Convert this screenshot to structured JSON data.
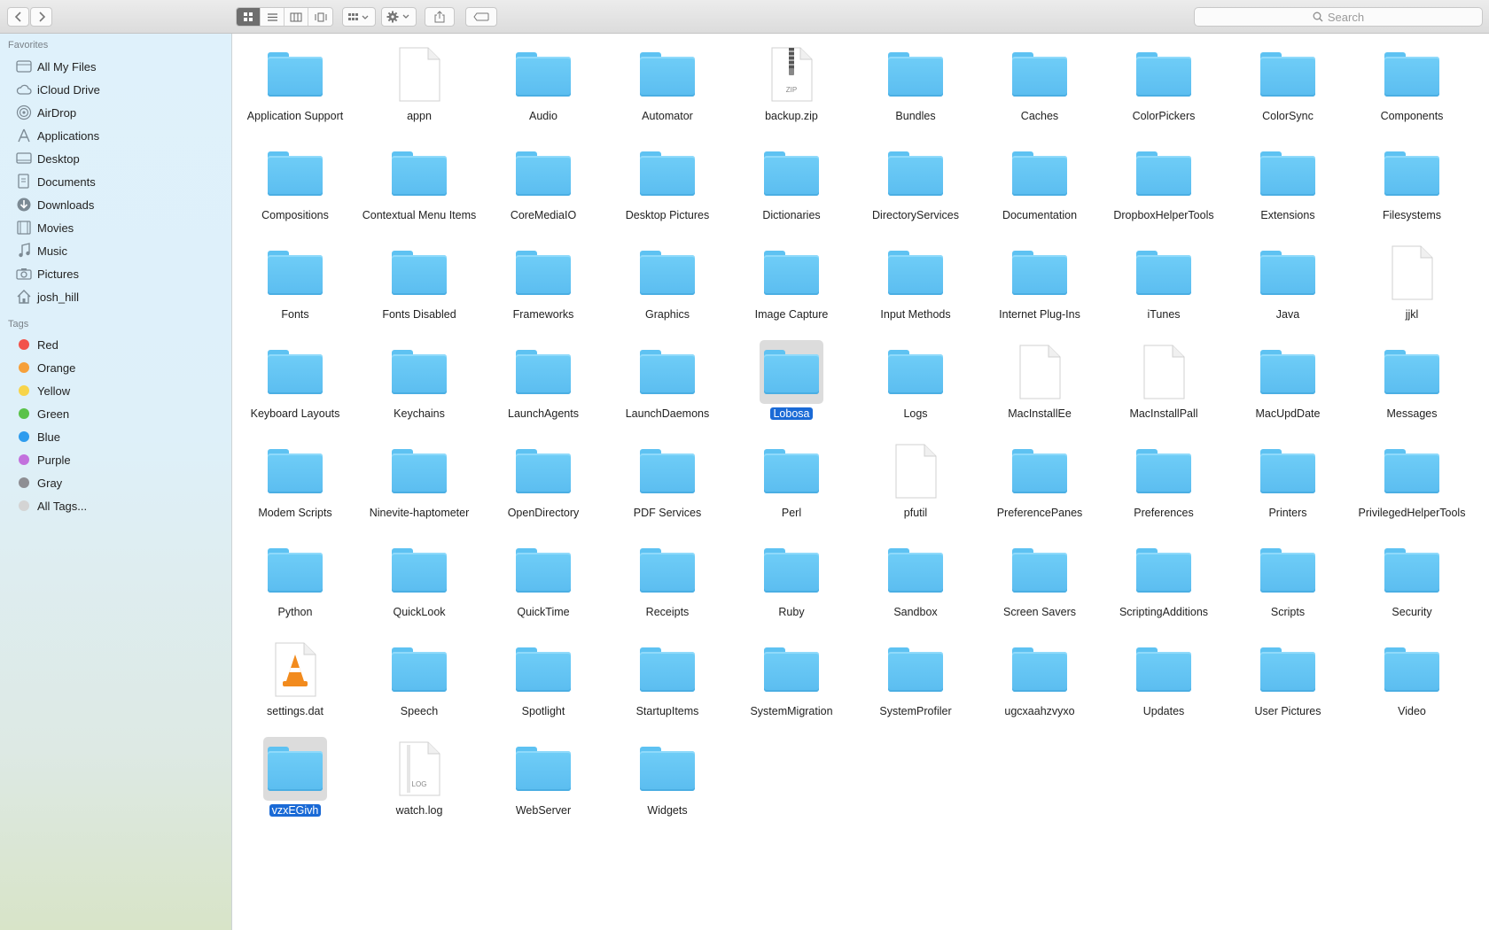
{
  "toolbar": {
    "back_icon": "chevron-left-icon",
    "forward_icon": "chevron-right-icon",
    "search_placeholder": "Search"
  },
  "sidebar": {
    "favorites_header": "Favorites",
    "favorites": [
      {
        "label": "All My Files",
        "icon": "all-files-icon"
      },
      {
        "label": "iCloud Drive",
        "icon": "cloud-icon"
      },
      {
        "label": "AirDrop",
        "icon": "airdrop-icon"
      },
      {
        "label": "Applications",
        "icon": "applications-icon"
      },
      {
        "label": "Desktop",
        "icon": "desktop-icon"
      },
      {
        "label": "Documents",
        "icon": "documents-icon"
      },
      {
        "label": "Downloads",
        "icon": "downloads-icon"
      },
      {
        "label": "Movies",
        "icon": "movies-icon"
      },
      {
        "label": "Music",
        "icon": "music-icon"
      },
      {
        "label": "Pictures",
        "icon": "camera-icon"
      },
      {
        "label": "josh_hill",
        "icon": "home-icon"
      }
    ],
    "tags_header": "Tags",
    "tags": [
      {
        "label": "Red",
        "color": "#f2534b"
      },
      {
        "label": "Orange",
        "color": "#f6a03a"
      },
      {
        "label": "Yellow",
        "color": "#f7d44a"
      },
      {
        "label": "Green",
        "color": "#5ac249"
      },
      {
        "label": "Blue",
        "color": "#2e9cee"
      },
      {
        "label": "Purple",
        "color": "#c271dd"
      },
      {
        "label": "Gray",
        "color": "#8e8e93"
      },
      {
        "label": "All Tags...",
        "color": "#d4d4d4"
      }
    ]
  },
  "files": [
    {
      "name": "Application Support",
      "kind": "folder"
    },
    {
      "name": "appn",
      "kind": "doc"
    },
    {
      "name": "Audio",
      "kind": "folder"
    },
    {
      "name": "Automator",
      "kind": "folder"
    },
    {
      "name": "backup.zip",
      "kind": "zip",
      "badge": "ZIP"
    },
    {
      "name": "Bundles",
      "kind": "folder"
    },
    {
      "name": "Caches",
      "kind": "folder"
    },
    {
      "name": "ColorPickers",
      "kind": "folder"
    },
    {
      "name": "ColorSync",
      "kind": "folder"
    },
    {
      "name": "Components",
      "kind": "folder"
    },
    {
      "name": "Compositions",
      "kind": "folder"
    },
    {
      "name": "Contextual Menu Items",
      "kind": "folder"
    },
    {
      "name": "CoreMediaIO",
      "kind": "folder"
    },
    {
      "name": "Desktop Pictures",
      "kind": "folder"
    },
    {
      "name": "Dictionaries",
      "kind": "folder"
    },
    {
      "name": "DirectoryServices",
      "kind": "folder"
    },
    {
      "name": "Documentation",
      "kind": "folder"
    },
    {
      "name": "DropboxHelperTools",
      "kind": "folder"
    },
    {
      "name": "Extensions",
      "kind": "folder"
    },
    {
      "name": "Filesystems",
      "kind": "folder"
    },
    {
      "name": "Fonts",
      "kind": "folder"
    },
    {
      "name": "Fonts Disabled",
      "kind": "folder"
    },
    {
      "name": "Frameworks",
      "kind": "folder"
    },
    {
      "name": "Graphics",
      "kind": "folder"
    },
    {
      "name": "Image Capture",
      "kind": "folder"
    },
    {
      "name": "Input Methods",
      "kind": "folder"
    },
    {
      "name": "Internet Plug-Ins",
      "kind": "folder"
    },
    {
      "name": "iTunes",
      "kind": "folder"
    },
    {
      "name": "Java",
      "kind": "folder"
    },
    {
      "name": "jjkl",
      "kind": "doc"
    },
    {
      "name": "Keyboard Layouts",
      "kind": "folder"
    },
    {
      "name": "Keychains",
      "kind": "folder"
    },
    {
      "name": "LaunchAgents",
      "kind": "folder"
    },
    {
      "name": "LaunchDaemons",
      "kind": "folder"
    },
    {
      "name": "Lobosa",
      "kind": "folder",
      "selected": true
    },
    {
      "name": "Logs",
      "kind": "folder"
    },
    {
      "name": "MacInstallEe",
      "kind": "doc"
    },
    {
      "name": "MacInstallPall",
      "kind": "doc"
    },
    {
      "name": "MacUpdDate",
      "kind": "folder"
    },
    {
      "name": "Messages",
      "kind": "folder"
    },
    {
      "name": "Modem Scripts",
      "kind": "folder"
    },
    {
      "name": "Ninevite-haptometer",
      "kind": "folder"
    },
    {
      "name": "OpenDirectory",
      "kind": "folder"
    },
    {
      "name": "PDF Services",
      "kind": "folder"
    },
    {
      "name": "Perl",
      "kind": "folder"
    },
    {
      "name": "pfutil",
      "kind": "doc"
    },
    {
      "name": "PreferencePanes",
      "kind": "folder"
    },
    {
      "name": "Preferences",
      "kind": "folder"
    },
    {
      "name": "Printers",
      "kind": "folder"
    },
    {
      "name": "PrivilegedHelperTools",
      "kind": "folder"
    },
    {
      "name": "Python",
      "kind": "folder"
    },
    {
      "name": "QuickLook",
      "kind": "folder"
    },
    {
      "name": "QuickTime",
      "kind": "folder"
    },
    {
      "name": "Receipts",
      "kind": "folder"
    },
    {
      "name": "Ruby",
      "kind": "folder"
    },
    {
      "name": "Sandbox",
      "kind": "folder"
    },
    {
      "name": "Screen Savers",
      "kind": "folder"
    },
    {
      "name": "ScriptingAdditions",
      "kind": "folder"
    },
    {
      "name": "Scripts",
      "kind": "folder"
    },
    {
      "name": "Security",
      "kind": "folder"
    },
    {
      "name": "settings.dat",
      "kind": "vlc"
    },
    {
      "name": "Speech",
      "kind": "folder"
    },
    {
      "name": "Spotlight",
      "kind": "folder"
    },
    {
      "name": "StartupItems",
      "kind": "folder"
    },
    {
      "name": "SystemMigration",
      "kind": "folder"
    },
    {
      "name": "SystemProfiler",
      "kind": "folder"
    },
    {
      "name": "ugcxaahzvyxo",
      "kind": "folder"
    },
    {
      "name": "Updates",
      "kind": "folder"
    },
    {
      "name": "User Pictures",
      "kind": "folder"
    },
    {
      "name": "Video",
      "kind": "folder"
    },
    {
      "name": "vzxEGivh",
      "kind": "folder",
      "selected": true
    },
    {
      "name": "watch.log",
      "kind": "log",
      "badge": "LOG"
    },
    {
      "name": "WebServer",
      "kind": "folder"
    },
    {
      "name": "Widgets",
      "kind": "folder"
    }
  ]
}
